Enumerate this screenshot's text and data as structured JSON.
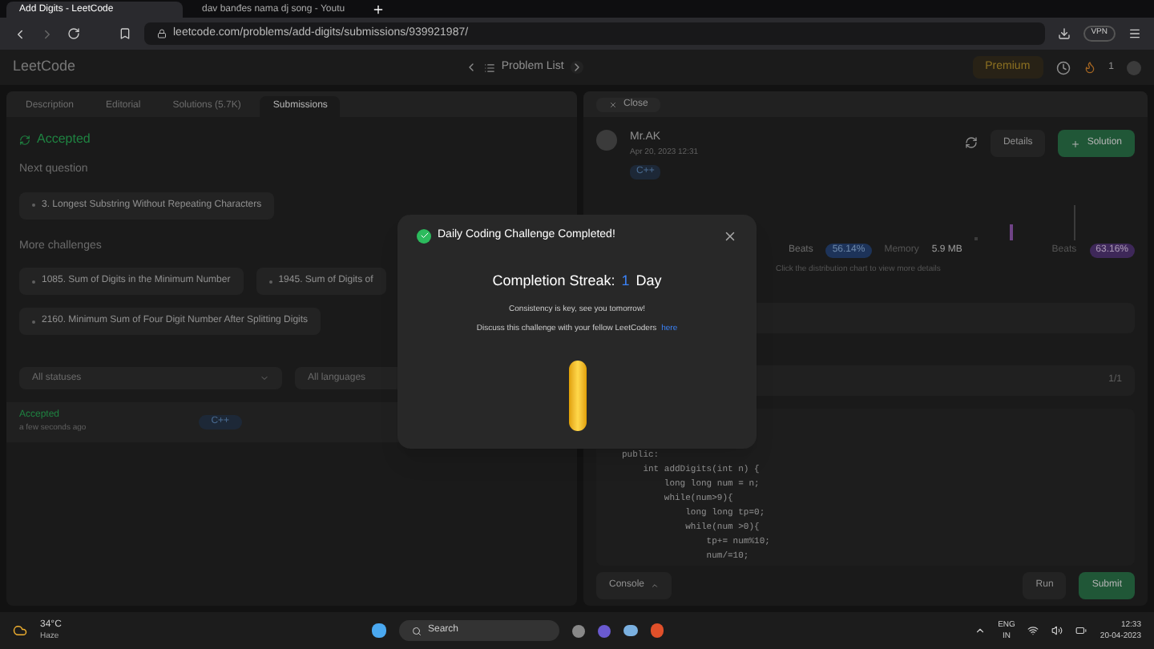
{
  "browser": {
    "tabs": [
      {
        "title": "Add Digits - LeetCode",
        "selected": true
      },
      {
        "title": "dav banđes nama dj song - Youtu",
        "selected": false
      }
    ],
    "url": "leetcode.com/problems/add-digits/submissions/939921987/",
    "vpn": "VPN"
  },
  "nav": {
    "logo": "LeetCode",
    "problem_list": "Problem List",
    "premium": "Premium",
    "streak": "1"
  },
  "left_tabs": [
    {
      "label": "Description",
      "selected": false
    },
    {
      "label": "Editorial",
      "selected": false
    },
    {
      "label": "Solutions (5.7K)",
      "selected": false
    },
    {
      "label": "Submissions",
      "selected": true
    }
  ],
  "close": "Close",
  "result": {
    "status": "Accepted",
    "next_label": "Next question",
    "next": "3. Longest Substring Without Repeating Characters",
    "more_label": "More challenges",
    "more": [
      "1085. Sum of Digits in the Minimum Number",
      "1945. Sum of Digits of",
      "2160. Minimum Sum of Four Digit Number After Splitting Digits"
    ],
    "filters": [
      "All statuses",
      "All languages"
    ],
    "submission": {
      "status": "Accepted",
      "time": "a few seconds ago",
      "language": "C++"
    }
  },
  "detail": {
    "user": "Mr.AK",
    "date": "Apr 20, 2023 12:31",
    "language": "C++",
    "details": "Details",
    "solution": "Solution",
    "runtime_label": "Beats",
    "runtime_beats": "56.14%",
    "memory_label": "Memory",
    "memory": "5.9 MB",
    "memory_beats_label": "Beats",
    "memory_beats": "63.16%",
    "hint": "Click the distribution chart to view more details",
    "pager": "1/1",
    "code": [
      "public:",
      "    int addDigits(int n) {",
      "        long long num = n;",
      "        while(num>9){",
      "            long long tp=0;",
      "            while(num >0){",
      "                tp+= num%10;",
      "                num/=10;"
    ],
    "console": "Console",
    "run": "Run",
    "submit": "Submit"
  },
  "modal": {
    "title": "Daily Coding Challenge Completed!",
    "streak_label": "Completion Streak:",
    "streak_value": "1",
    "streak_unit": "Day",
    "message": "Consistency is key, see you tomorrow!",
    "discuss": "Discuss this challenge with your fellow LeetCoders",
    "link": "here"
  },
  "taskbar": {
    "temp": "34°C",
    "weather": "Haze",
    "search": "Search",
    "lang": "ENG",
    "region": "IN",
    "time": "12:33",
    "date": "20-04-2023"
  }
}
